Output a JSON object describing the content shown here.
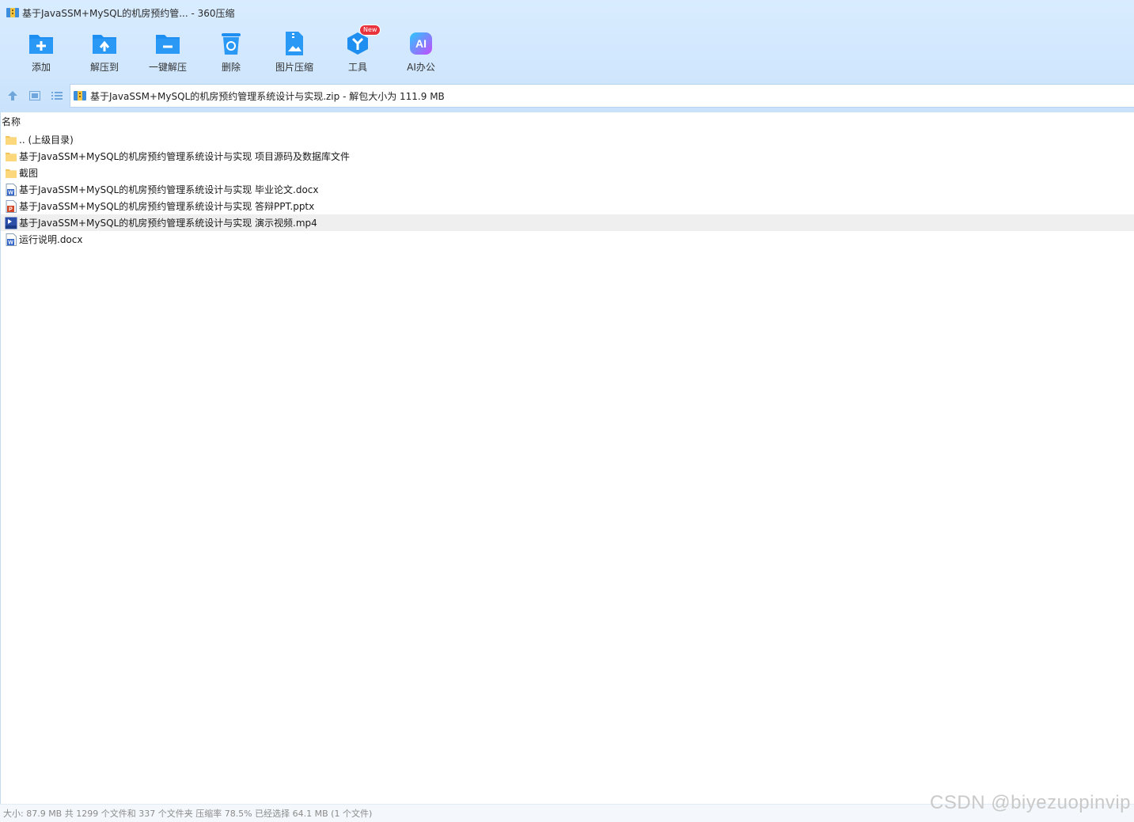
{
  "window": {
    "title": "基于JavaSSM+MySQL的机房预约管... - 360压缩"
  },
  "toolbar": [
    {
      "label": "添加",
      "icon": "add-icon"
    },
    {
      "label": "解压到",
      "icon": "extract-to-icon"
    },
    {
      "label": "一键解压",
      "icon": "one-click-extract-icon"
    },
    {
      "label": "删除",
      "icon": "delete-icon"
    },
    {
      "label": "图片压缩",
      "icon": "image-compress-icon"
    },
    {
      "label": "工具",
      "icon": "tools-icon",
      "badge": "New"
    },
    {
      "label": "AI办公",
      "icon": "ai-office-icon"
    }
  ],
  "navbar": {
    "icons": [
      "up-arrow-icon",
      "thumbnail-view-icon",
      "list-view-icon"
    ],
    "address": "基于JavaSSM+MySQL的机房预约管理系统设计与实现.zip - 解包大小为 111.9 MB"
  },
  "list": {
    "column_name": "名称",
    "rows": [
      {
        "name": ".. (上级目录)",
        "type": "folder"
      },
      {
        "name": "基于JavaSSM+MySQL的机房预约管理系统设计与实现 项目源码及数据库文件",
        "type": "folder"
      },
      {
        "name": "截图",
        "type": "folder"
      },
      {
        "name": "基于JavaSSM+MySQL的机房预约管理系统设计与实现 毕业论文.docx",
        "type": "word"
      },
      {
        "name": "基于JavaSSM+MySQL的机房预约管理系统设计与实现 答辩PPT.pptx",
        "type": "ppt"
      },
      {
        "name": "基于JavaSSM+MySQL的机房预约管理系统设计与实现 演示视频.mp4",
        "type": "video",
        "selected": true
      },
      {
        "name": "运行说明.docx",
        "type": "word"
      }
    ]
  },
  "status": {
    "text": "大小: 87.9 MB 共 1299 个文件和 337 个文件夹 压缩率 78.5% 已经选择 64.1 MB (1 个文件)"
  },
  "watermark": "CSDN @biyezuopinvip",
  "colors": {
    "accent": "#1e8ff0",
    "header_bg": "#d6eafe",
    "selected_row": "#efefef"
  }
}
